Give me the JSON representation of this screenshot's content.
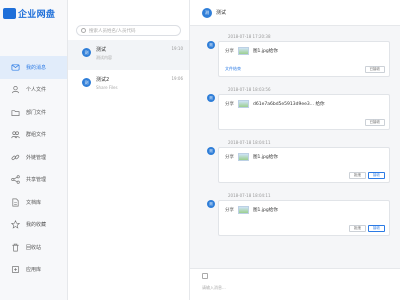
{
  "app": {
    "title": "企业网盘"
  },
  "sidebar": {
    "items": [
      {
        "label": "我的消息",
        "icon": "message-icon",
        "active": true
      },
      {
        "label": "个人文件",
        "icon": "user-icon",
        "active": false
      },
      {
        "label": "部门文件",
        "icon": "folder-icon",
        "active": false
      },
      {
        "label": "群组文件",
        "icon": "group-icon",
        "active": false
      },
      {
        "label": "外链管理",
        "icon": "link-icon",
        "active": false
      },
      {
        "label": "共享管理",
        "icon": "share-icon",
        "active": false
      },
      {
        "label": "文档库",
        "icon": "document-icon",
        "active": false
      },
      {
        "label": "我的收藏",
        "icon": "star-icon",
        "active": false
      },
      {
        "label": "回收站",
        "icon": "trash-icon",
        "active": false
      },
      {
        "label": "应用库",
        "icon": "app-icon",
        "active": false
      }
    ]
  },
  "search": {
    "placeholder": "搜索人员姓名/人员代码"
  },
  "conversations": [
    {
      "name": "测试",
      "avatar": "测",
      "preview": "测试内容",
      "time": "19:10",
      "active": true
    },
    {
      "name": "测试2",
      "avatar": "测",
      "preview": "Share Files",
      "time": "19:06",
      "active": false
    }
  ],
  "chat": {
    "header_name": "测试",
    "header_avatar": "测",
    "messages": [
      {
        "timestamp": "2018-07-18 17:20:38",
        "avatar": "测",
        "verb": "分享",
        "file": "图1.jpg给你",
        "sub": "文件结束",
        "buttons": [
          "已接收"
        ]
      },
      {
        "timestamp": "2018-07-18 18:03:56",
        "avatar": "测",
        "verb": "分享",
        "file": "d61e7a6bd5e5913d9ee3... 给你",
        "sub": "",
        "buttons": [
          "已接收"
        ]
      },
      {
        "timestamp": "2018-07-18 18:04:11",
        "avatar": "测",
        "verb": "分享",
        "file": "图1.jpg给你",
        "sub": "",
        "buttons": [
          "拒绝",
          "接收"
        ]
      },
      {
        "timestamp": "2018-07-18 18:04:11",
        "avatar": "测",
        "verb": "分享",
        "file": "图1.jpg给你",
        "sub": "",
        "buttons": [
          "拒绝",
          "接收"
        ]
      }
    ],
    "composer_placeholder": "请输入消息..."
  },
  "colors": {
    "accent": "#2c7be5",
    "brand": "#1e6fd9"
  }
}
